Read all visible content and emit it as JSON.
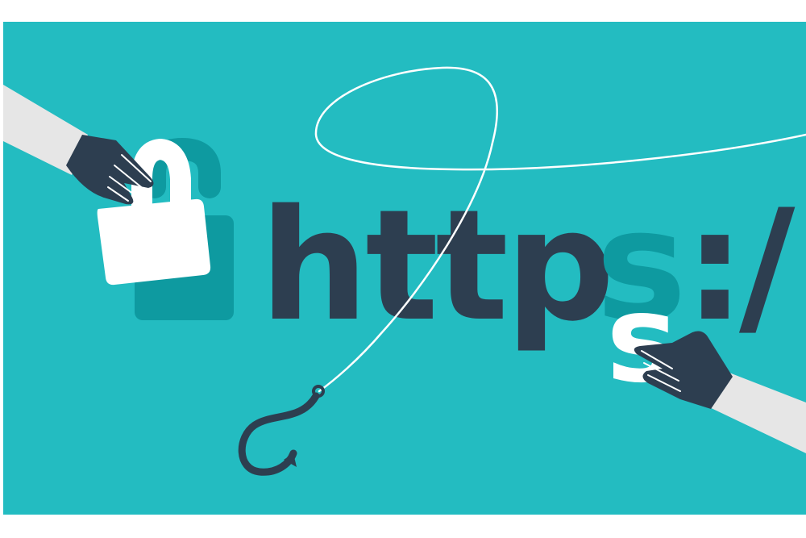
{
  "illustration": {
    "url_text": {
      "prefix": "http",
      "ghost_letter": "s",
      "suffix": ":/"
    },
    "stolen_letter": "s",
    "colors": {
      "background": "#23bcc1",
      "text_dark": "#2d3e50",
      "ghost": "#0e9aa0",
      "white": "#ffffff",
      "sleeve": "#e6e6e6"
    },
    "icons": [
      "padlock-icon",
      "fishing-hook-icon",
      "fishing-line-icon",
      "left-hand-icon",
      "right-hand-icon"
    ]
  }
}
